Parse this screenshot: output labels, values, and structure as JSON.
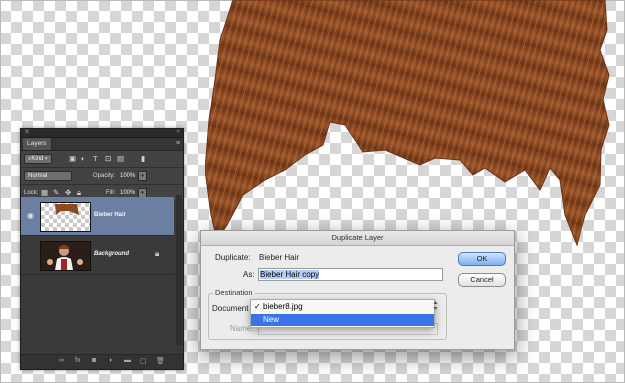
{
  "layers_panel": {
    "tab_label": "Layers",
    "kind_filter": "Kind",
    "blend_mode": "Normal",
    "opacity_label": "Opacity:",
    "opacity_value": "100%",
    "lock_label": "Lock:",
    "fill_label": "Fill:",
    "fill_value": "100%",
    "layers": [
      {
        "name": "Bieber Hair",
        "visible": true,
        "selected": true
      },
      {
        "name": "Background",
        "visible": false,
        "selected": false,
        "locked": true
      }
    ]
  },
  "dialog": {
    "title": "Duplicate Layer",
    "duplicate_label": "Duplicate:",
    "duplicate_value": "Bieber Hair",
    "as_label": "As:",
    "as_value": "Bieber Hair copy",
    "ok_label": "OK",
    "cancel_label": "Cancel",
    "destination_label": "Destination",
    "document_label": "Document",
    "name_label": "Name:",
    "document_options": [
      {
        "label": "bieber8.jpg",
        "checked": true
      },
      {
        "label": "New",
        "checked": false,
        "highlighted": true
      }
    ]
  },
  "colors": {
    "hair": "#8a4a22",
    "panel_bg": "#3a3a3a",
    "selection_blue": "#3a73e5",
    "selected_layer": "#6b7fa3"
  }
}
